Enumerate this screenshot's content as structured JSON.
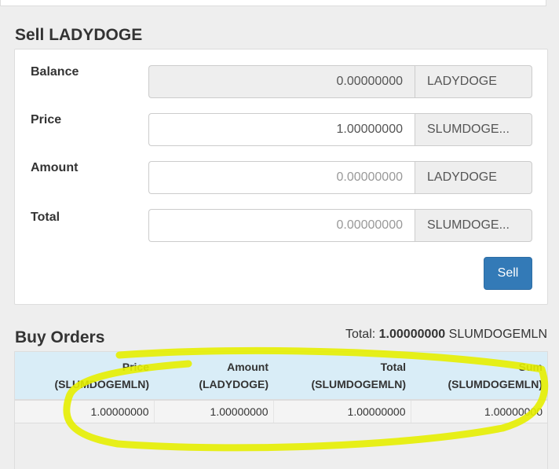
{
  "sell": {
    "title": "Sell LADYDOGE",
    "rows": [
      {
        "label": "Balance",
        "value": "0.00000000",
        "placeholder": "",
        "unit": "LADYDOGE"
      },
      {
        "label": "Price",
        "value": "1.00000000",
        "placeholder": "",
        "unit": "SLUMDOGE..."
      },
      {
        "label": "Amount",
        "value": "",
        "placeholder": "0.00000000",
        "unit": "LADYDOGE"
      },
      {
        "label": "Total",
        "value": "",
        "placeholder": "0.00000000",
        "unit": "SLUMDOGE..."
      }
    ],
    "button_label": "Sell",
    "button_color": "#337ab7"
  },
  "buy_orders": {
    "title": "Buy Orders",
    "total_label": "Total:",
    "total_value": "1.00000000",
    "total_unit": "SLUMDOGEMLN",
    "columns": [
      {
        "name": "Price",
        "unit": "(SLUMDOGEMLN)"
      },
      {
        "name": "Amount",
        "unit": "(LADYDOGE)"
      },
      {
        "name": "Total",
        "unit": "(SLUMDOGEMLN)"
      },
      {
        "name": "Sum",
        "unit": "(SLUMDOGEMLN)"
      }
    ],
    "rows": [
      [
        "1.00000000",
        "1.00000000",
        "1.00000000",
        "1.00000000"
      ]
    ],
    "header_color": "#d9edf7"
  },
  "annotation": {
    "color": "#e6ee00"
  }
}
